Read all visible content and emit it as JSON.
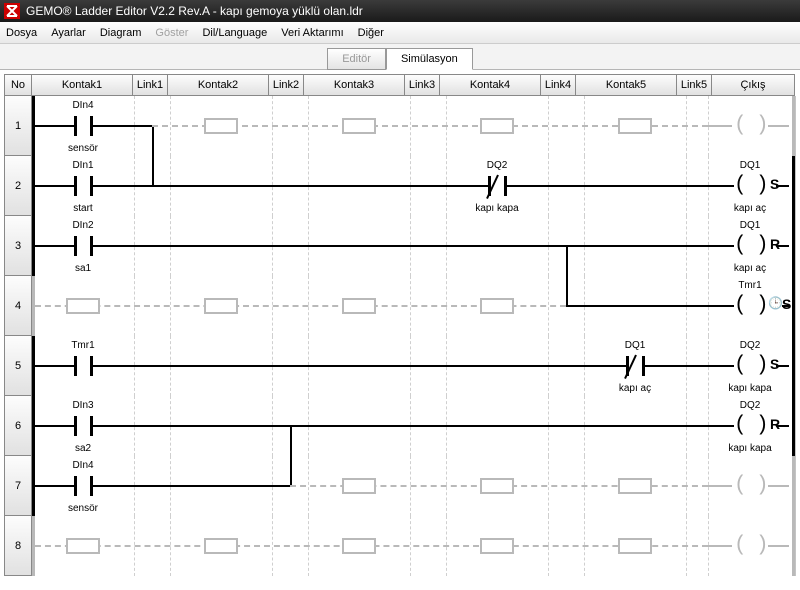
{
  "titlebar": {
    "text": "GEMO® Ladder Editor V2.2 Rev.A - kapı gemoya yüklü olan.ldr"
  },
  "menu": {
    "items": [
      "Dosya",
      "Ayarlar",
      "Diagram",
      "Göster",
      "Dil/Language",
      "Veri Aktarımı",
      "Diğer"
    ],
    "disabled_index": 3
  },
  "tabs": {
    "editor": "Editör",
    "simulation": "Simülasyon"
  },
  "header": {
    "no": "No",
    "k": [
      "Kontak1",
      "Kontak2",
      "Kontak3",
      "Kontak4",
      "Kontak5"
    ],
    "l": [
      "Link1",
      "Link2",
      "Link3",
      "Link4",
      "Link5"
    ],
    "out": "Çıkış"
  },
  "rungs": [
    {
      "no": "1",
      "k1": {
        "kind": "NO",
        "top": "DIn4",
        "bot": "sensör"
      },
      "link": "down1",
      "out": {
        "kind": "ph-coil"
      },
      "ph": [
        "k2",
        "k3",
        "k4",
        "k5"
      ]
    },
    {
      "no": "2",
      "k1": {
        "kind": "NO",
        "top": "DIn1",
        "bot": "start"
      },
      "k4": {
        "kind": "NC",
        "top": "DQ2",
        "bot": "kapı kapa"
      },
      "out": {
        "kind": "coil",
        "top": "DQ1",
        "bot": "kapı aç",
        "suffix": "S"
      }
    },
    {
      "no": "3",
      "k1": {
        "kind": "NO",
        "top": "DIn2",
        "bot": "sa1"
      },
      "branchdown4": true,
      "out": {
        "kind": "coil",
        "top": "DQ1",
        "bot": "kapı aç",
        "suffix": "R"
      }
    },
    {
      "no": "4",
      "ph": [
        "k1",
        "k2",
        "k3",
        "k4"
      ],
      "seg5": true,
      "out": {
        "kind": "coil",
        "top": "Tmr1",
        "bot": "",
        "suffix": "S",
        "timer": true
      }
    },
    {
      "no": "5",
      "k1": {
        "kind": "NO",
        "top": "Tmr1",
        "bot": ""
      },
      "k5": {
        "kind": "NC",
        "top": "DQ1",
        "bot": "kapı aç"
      },
      "out": {
        "kind": "coil",
        "top": "DQ2",
        "bot": "kapı kapa",
        "suffix": "S"
      }
    },
    {
      "no": "6",
      "k1": {
        "kind": "NO",
        "top": "DIn3",
        "bot": "sa2"
      },
      "seg2": true,
      "branchdown2": true,
      "out": {
        "kind": "coil",
        "top": "DQ2",
        "bot": "kapı kapa",
        "suffix": "R"
      }
    },
    {
      "no": "7",
      "k1": {
        "kind": "NO",
        "top": "DIn4",
        "bot": "sensör"
      },
      "seg2": true,
      "ph": [
        "k3",
        "k4",
        "k5"
      ],
      "out": {
        "kind": "ph-coil"
      }
    },
    {
      "no": "8",
      "ph": [
        "k1",
        "k2",
        "k3",
        "k4",
        "k5"
      ],
      "out": {
        "kind": "ph-coil"
      }
    }
  ]
}
